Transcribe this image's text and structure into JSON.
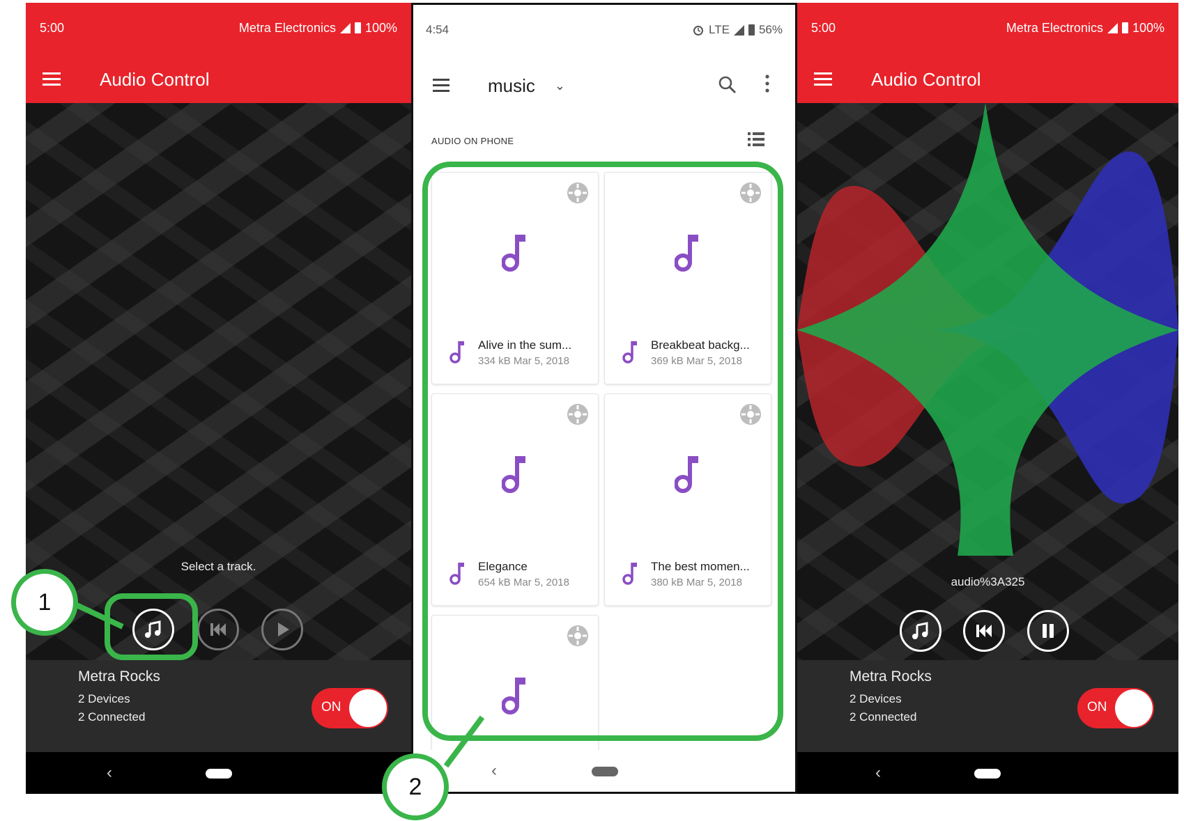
{
  "audio_app": {
    "status_time": "5:00",
    "carrier": "Metra Electronics",
    "battery": "100%",
    "title": "Audio Control",
    "device_name": "Metra Rocks",
    "devices_count": "2 Devices",
    "connected_count": "2 Connected",
    "toggle_label": "ON",
    "nav_back": "‹"
  },
  "left_screen": {
    "player_status": "Select a track."
  },
  "right_screen": {
    "track_name": "audio%3A325"
  },
  "file_browser": {
    "status_time": "4:54",
    "network": "LTE",
    "battery": "56%",
    "title": "music",
    "section_label": "AUDIO ON PHONE",
    "nav_back": "‹",
    "files": [
      {
        "name": "Alive in the sum...",
        "meta": "334 kB Mar 5, 2018"
      },
      {
        "name": "Breakbeat backg...",
        "meta": "369 kB Mar 5, 2018"
      },
      {
        "name": "Elegance",
        "meta": "654 kB Mar 5, 2018"
      },
      {
        "name": "The best momen...",
        "meta": "380 kB Mar 5, 2018"
      },
      {
        "name": "",
        "meta": ""
      }
    ]
  },
  "callouts": {
    "step1": "1",
    "step2": "2"
  },
  "colors": {
    "brand_red": "#e8232b",
    "callout_green": "#3ab54a",
    "note_purple": "#8a4ec4",
    "viz_red": "#b5242a",
    "viz_green": "#1fa94c",
    "viz_blue": "#2f2fb4"
  }
}
